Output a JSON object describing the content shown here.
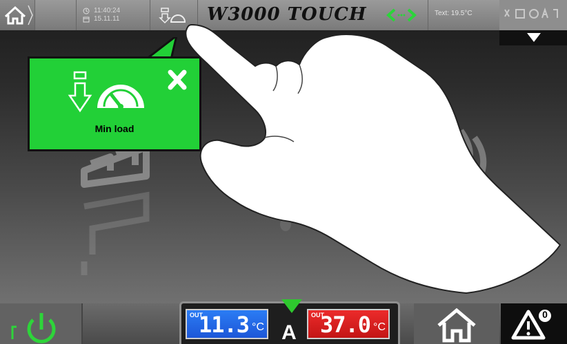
{
  "topbar": {
    "time": "11:40:24",
    "date": "15.11.11",
    "title": "W3000 TOUCH",
    "external_temp": "Text: 19.5°C"
  },
  "popup": {
    "label": "Min load",
    "icons": [
      "download-arrow-icon",
      "gauge-icon",
      "close-icon"
    ]
  },
  "display": {
    "left": {
      "tag": "OUT",
      "value": "11.3",
      "unit": "°C",
      "color": "#1d57d8"
    },
    "right": {
      "tag": "OUT",
      "value": "37.0",
      "unit": "°C",
      "color": "#c31515"
    },
    "mode": "A"
  },
  "alarm": {
    "count": "0"
  },
  "colors": {
    "accent": "#22d037",
    "mode_indicator": "#2ec82e"
  },
  "icons": [
    "home-icon",
    "clock-icon",
    "calendar-icon",
    "min-load-icon",
    "scroll-arrows-icon",
    "status-icons",
    "dropdown-arrow-icon",
    "power-icon",
    "warning-icon",
    "hand-pointer-illustration"
  ]
}
